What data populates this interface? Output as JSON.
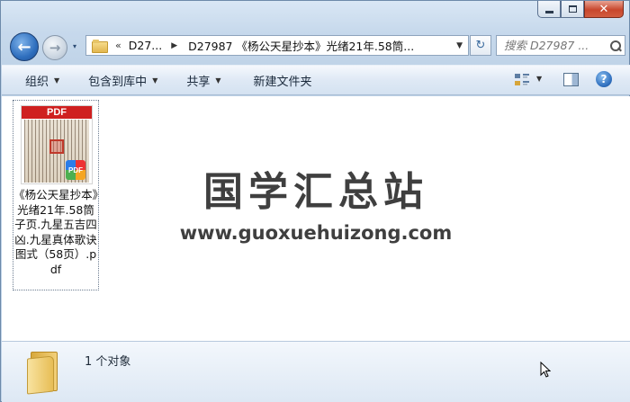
{
  "window": {
    "controls": {
      "minimize": "minimize",
      "maximize": "maximize",
      "close": "✕"
    }
  },
  "navigation": {
    "back_glyph": "←",
    "forward_glyph": "→",
    "history_glyph": "▾",
    "breadcrumb_overflow": "«",
    "breadcrumb": [
      "D27...",
      "D27987 《杨公天星抄本》光绪21年.58筒..."
    ],
    "refresh_glyph": "↻",
    "search_placeholder": "搜索 D27987 ..."
  },
  "toolbar": {
    "organize": "组织",
    "include_in_library": "包含到库中",
    "share": "共享",
    "new_folder": "新建文件夹",
    "help": "?"
  },
  "content": {
    "files": [
      {
        "thumbnail_band": "PDF",
        "badge": "PDF",
        "name": "《杨公天星抄本》光绪21年.58筒子页.九星五吉四凶.九星真体歌诀图式（58页）.pdf"
      }
    ],
    "watermark": {
      "title": "国学汇总站",
      "url": "www.guoxuehuizong.com"
    }
  },
  "details": {
    "count_text": "1 个对象"
  },
  "colors": {
    "accent": "#2f6fbe",
    "close": "#c8472d",
    "pdf_red": "#cf2020"
  }
}
